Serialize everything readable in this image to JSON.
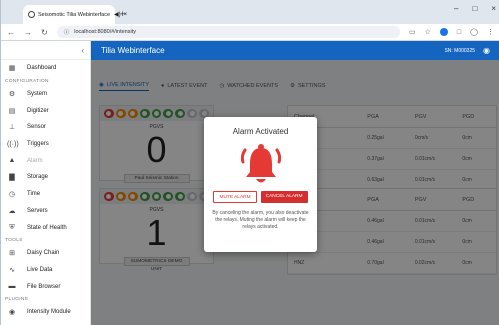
{
  "browser": {
    "tab_title": "Seisomotic Tilia Webinterface",
    "url": "localhost:8080/#/intensity",
    "new_tab": "+",
    "win_min": "–",
    "win_max": "□",
    "win_close": "×"
  },
  "app": {
    "title": "Tilia Webinterface",
    "serial": "SN: M000325",
    "sidebar_collapse": "‹"
  },
  "sidebar": {
    "items_top": [
      {
        "label": "Dashboard",
        "icon": "dashboard-icon",
        "glyph": "▦"
      }
    ],
    "section_config": "CONFIGURATION",
    "items_config": [
      {
        "label": "System",
        "icon": "gear-icon",
        "glyph": "⚙"
      },
      {
        "label": "Digitizer",
        "icon": "digitizer-icon",
        "glyph": "▤"
      },
      {
        "label": "Sensor",
        "icon": "sensor-icon",
        "glyph": "⊥"
      },
      {
        "label": "Triggers",
        "icon": "trigger-icon",
        "glyph": "((·))"
      },
      {
        "label": "Alarm",
        "icon": "alarm-icon",
        "glyph": "▲"
      },
      {
        "label": "Storage",
        "icon": "storage-icon",
        "glyph": "▇"
      },
      {
        "label": "Time",
        "icon": "clock-icon",
        "glyph": "◷"
      },
      {
        "label": "Servers",
        "icon": "cloud-icon",
        "glyph": "☁"
      },
      {
        "label": "State of Health",
        "icon": "shield-icon",
        "glyph": "⛨"
      }
    ],
    "section_tools": "TOOLS",
    "items_tools": [
      {
        "label": "Daisy Chain",
        "icon": "chain-icon",
        "glyph": "⊞"
      },
      {
        "label": "Live Data",
        "icon": "live-data-icon",
        "glyph": "∿"
      },
      {
        "label": "File Browser",
        "icon": "folder-icon",
        "glyph": "▬"
      }
    ],
    "section_plugins": "PLUGINS",
    "items_plugins": [
      {
        "label": "Intensity Module",
        "icon": "intensity-icon",
        "glyph": "◉"
      }
    ]
  },
  "tabs": [
    {
      "label": "LIVE INTENSITY",
      "glyph": "◉"
    },
    {
      "label": "LATEST EVENT",
      "glyph": "●"
    },
    {
      "label": "WATCHED EVENTS",
      "glyph": "◷"
    },
    {
      "label": "SETTINGS",
      "glyph": "⚙"
    }
  ],
  "stations": [
    {
      "chips": [
        "0",
        "1",
        "2",
        "3",
        "4",
        "5",
        "6",
        "7",
        "8"
      ],
      "pgv_label": "PGVS",
      "value": "0",
      "name": "Paul Seismic Station"
    },
    {
      "chips": [
        "0",
        "1",
        "2",
        "3",
        "4",
        "5",
        "6",
        "7",
        "8"
      ],
      "pgv_label": "PGVS",
      "value": "1",
      "name": "SUMOMETRICS DEMO UNIT"
    }
  ],
  "table_top": {
    "headers": [
      "Channel",
      "PGA",
      "PGV",
      "PGD"
    ],
    "rows": [
      [
        "HNE",
        "0.25gal",
        "0cm/s",
        "0cm"
      ],
      [
        "HNN",
        "0.37gal",
        "0.01cm/s",
        "0cm"
      ],
      [
        "HNZ",
        "0.63gal",
        "0.01cm/s",
        "0cm"
      ]
    ]
  },
  "table_bottom": {
    "headers": [
      "Channel",
      "PGA",
      "PGV",
      "PGD"
    ],
    "rows": [
      [
        "HNE",
        "0.46gal",
        "0.01cm/s",
        "0cm"
      ],
      [
        "HNN",
        "0.46gal",
        "0.01cm/s",
        "0cm"
      ],
      [
        "HNZ",
        "0.70gal",
        "0.02cm/s",
        "0cm"
      ]
    ]
  },
  "modal": {
    "title": "Alarm Activated",
    "mute_label": "MUTE ALARM",
    "cancel_label": "CANCEL ALARM",
    "text": "By canceling the alarm, you also deactivate the relays. Muting the alarm will keep the relays activated."
  },
  "colors": {
    "accent": "#1565c0",
    "alarm": "#e53935"
  }
}
